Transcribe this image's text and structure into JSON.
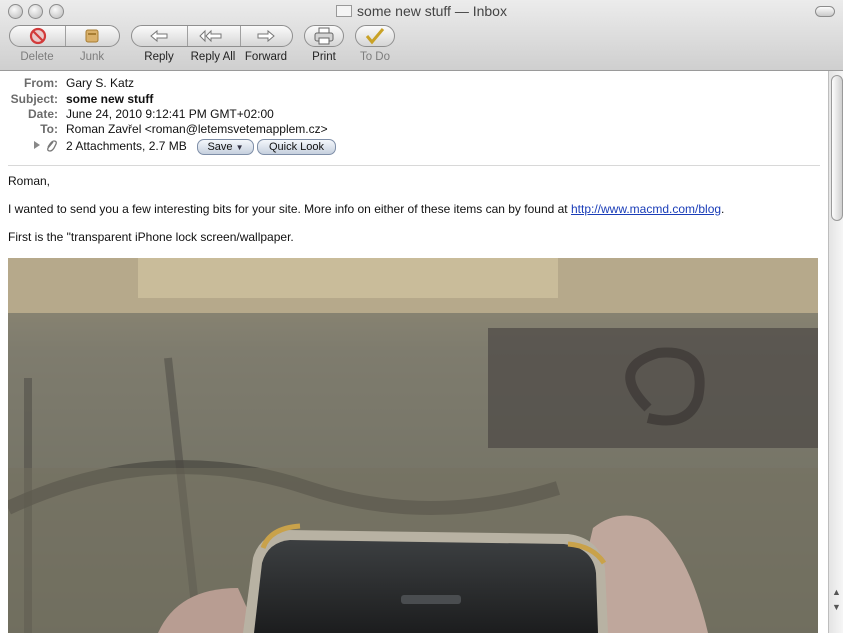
{
  "window": {
    "title": "some new stuff — Inbox"
  },
  "toolbar": {
    "delete_label": "Delete",
    "junk_label": "Junk",
    "reply_label": "Reply",
    "reply_all_label": "Reply All",
    "forward_label": "Forward",
    "print_label": "Print",
    "todo_label": "To Do"
  },
  "headers": {
    "from_label": "From:",
    "from_value": "Gary S. Katz",
    "subject_label": "Subject:",
    "subject_value": "some new stuff",
    "date_label": "Date:",
    "date_value": "June 24, 2010 9:12:41 PM GMT+02:00",
    "to_label": "To:",
    "to_value": "Roman Zavřel <roman@letemsvetemapplem.cz>",
    "attachments_value": "2 Attachments, 2.7 MB",
    "save_label": "Save",
    "quicklook_label": "Quick Look"
  },
  "message": {
    "greeting": "Roman,",
    "line1_text": "I wanted to send you a few interesting bits for your site.  More info on either of these items can by found at ",
    "line1_link": "http://www.macmd.com/blog",
    "line1_end": ".",
    "line2": "First is the \"transparent iPhone lock screen/wallpaper."
  },
  "colors": {
    "link": "#1a3db8",
    "toolbar_bg": "#d9d9d9",
    "header_label": "#6b6b6b"
  }
}
